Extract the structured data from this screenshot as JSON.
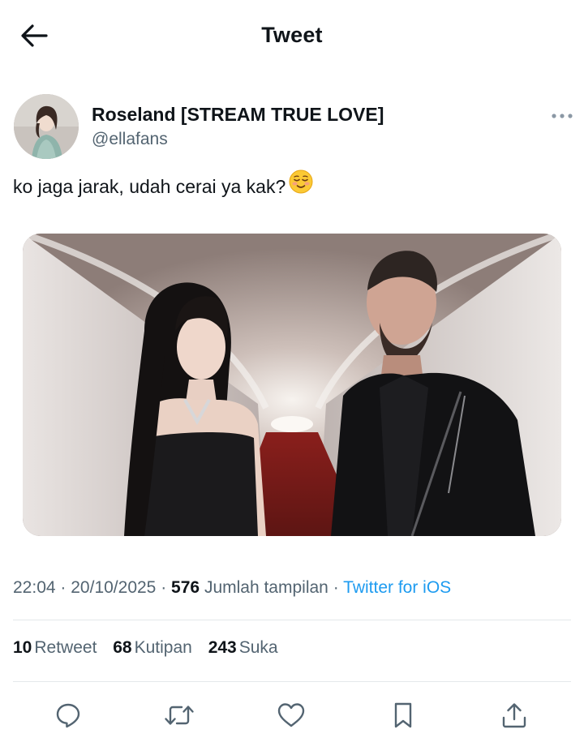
{
  "header": {
    "title": "Tweet",
    "back_icon": "arrow-left-icon"
  },
  "tweet": {
    "display_name": "Roseland [STREAM TRUE LOVE]",
    "handle": "@ellafans",
    "more_icon": "more-horizontal-icon",
    "text": "ko jaga jarak, udah cerai ya kak?",
    "emoji": "☺️",
    "media_icon": "photo"
  },
  "meta": {
    "time": "22:04",
    "separator": "·",
    "date": "20/10/2025",
    "views_count": "576",
    "views_label": "Jumlah tampilan",
    "source": "Twitter for iOS"
  },
  "stats": {
    "retweets_count": "10",
    "retweets_label": "Retweet",
    "quotes_count": "68",
    "quotes_label": "Kutipan",
    "likes_count": "243",
    "likes_label": "Suka"
  },
  "actions": [
    {
      "icon": "reply-icon"
    },
    {
      "icon": "retweet-icon"
    },
    {
      "icon": "like-icon"
    },
    {
      "icon": "bookmark-icon"
    },
    {
      "icon": "share-icon"
    }
  ],
  "colors": {
    "text": "#0f1419",
    "secondary": "#536471",
    "link": "#1d9bf0",
    "divider": "#e4e8eb",
    "icon": "#536471"
  }
}
